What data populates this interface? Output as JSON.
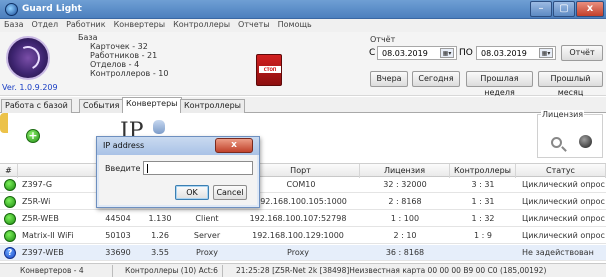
{
  "window": {
    "title": "Guard Light",
    "min_label": "–",
    "max_label": "▢",
    "close_label": "x"
  },
  "menu": [
    "База",
    "Отдел",
    "Работник",
    "Конвертеры",
    "Контроллеры",
    "Отчеты",
    "Помощь"
  ],
  "info": {
    "version": "Ver. 1.0.9.209",
    "base_header": "База",
    "stats": [
      "Карточек - 32",
      "Работников - 21",
      "Отделов - 4",
      "Контроллеров - 10"
    ],
    "alarm_label": "СТОП ОХРАНА"
  },
  "report": {
    "label": "Отчёт",
    "from_label": "С",
    "from_date": "08.03.2019",
    "to_label": "ПО",
    "to_date": "08.03.2019",
    "report_button": "Отчёт",
    "yesterday_button": "Вчера",
    "today_button": "Сегодня",
    "last_week_button": "Прошлая неделя",
    "last_month_button": "Прошлый месяц",
    "calendar_glyph": "▦▾"
  },
  "tabs": [
    "Работа с базой",
    "События",
    "Конвертеры",
    "Контроллеры"
  ],
  "active_tab": "Конвертеры",
  "toolbar": {
    "ip_glyph": "IP",
    "license_group": "Лицензия"
  },
  "table": {
    "headers": [
      "#",
      "Т",
      "Порт",
      "Лицензия",
      "Контроллеры",
      "Статус"
    ],
    "rows": [
      {
        "name": "Z397-G",
        "serial": "",
        "ver": "",
        "mode": "",
        "port": "COM10",
        "license": "32 : 32000",
        "controllers": "3 : 31",
        "status": "Циклический опрос",
        "icon": "ok"
      },
      {
        "name": "Z5R-Wi",
        "serial": "",
        "ver": "",
        "mode": "",
        "port": "192.168.100.105:1000",
        "license": "2 : 8168",
        "controllers": "1 : 31",
        "status": "Циклический опрос",
        "icon": "ok"
      },
      {
        "name": "Z5R-WEB",
        "serial": "44504",
        "ver": "1.130",
        "mode": "Client",
        "port": "192.168.100.107:52798",
        "license": "1 : 100",
        "controllers": "1 : 32",
        "status": "Циклический опрос",
        "icon": "ok"
      },
      {
        "name": "Matrix-II WiFi",
        "serial": "50103",
        "ver": "1.26",
        "mode": "Server",
        "port": "192.168.100.129:1000",
        "license": "2 : 10",
        "controllers": "1 : 9",
        "status": "Циклический опрос",
        "icon": "ok"
      },
      {
        "name": "Z397-WEB",
        "serial": "33690",
        "ver": "3.55",
        "mode": "Proxy",
        "port": "Proxy",
        "license": "36 : 8168",
        "controllers": "",
        "status": "Не задействован",
        "icon": "question"
      }
    ]
  },
  "statusbar": {
    "converters": "Конвертеров - 4",
    "controllers": "Контроллеры (10) Act:6",
    "event": "21:25:28 [Z5R-Net 2k [38498]Неизвестная карта 00 00 00 B9 00 C0 (185,00192)"
  },
  "dialog": {
    "title": "IP address",
    "close_label": "x",
    "field_label": "Введите",
    "field_value": "",
    "ok_label": "OK",
    "cancel_label": "Cancel"
  }
}
